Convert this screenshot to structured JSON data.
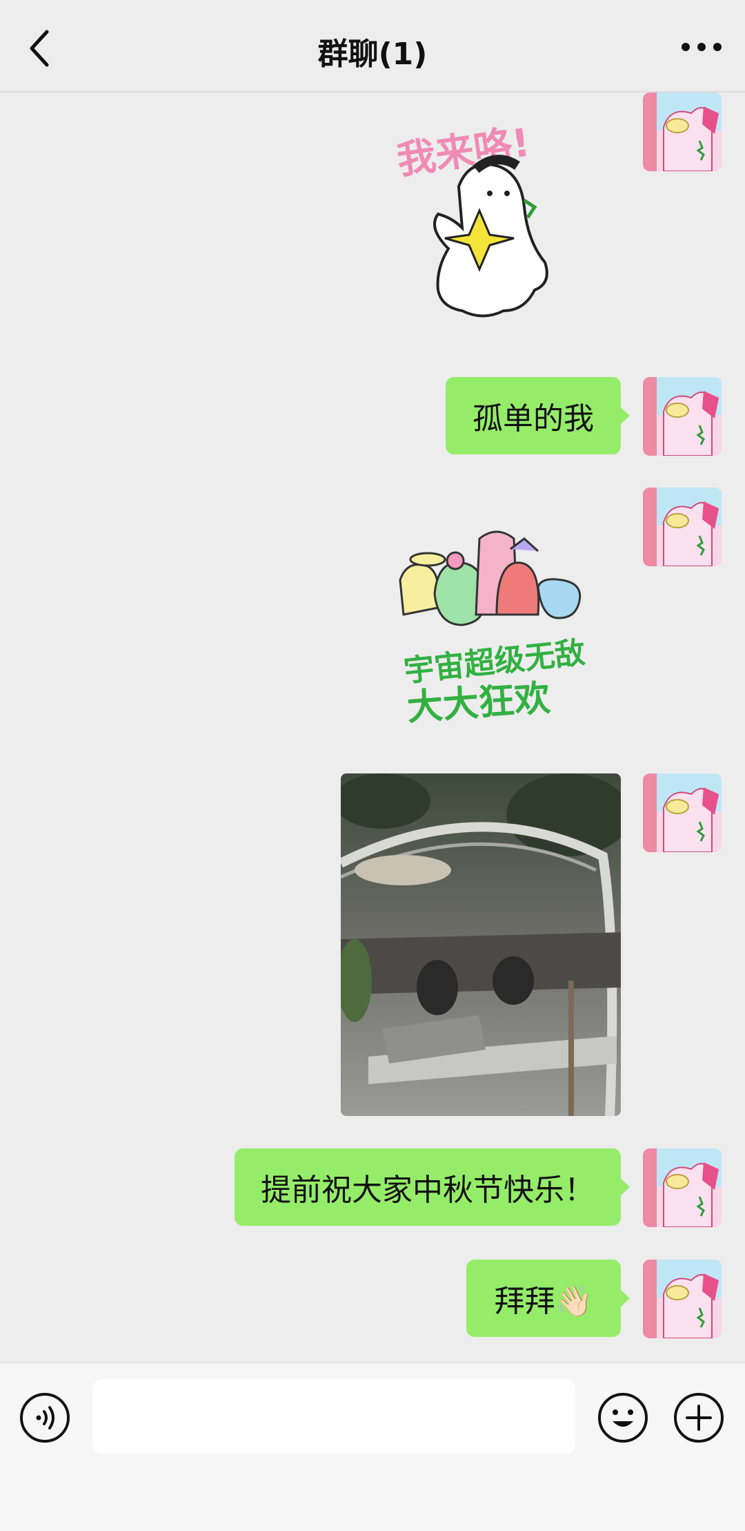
{
  "header": {
    "title": "群聊(1)",
    "back_icon": "chevron-left-icon",
    "more_icon": "more-dots-icon"
  },
  "messages": [
    {
      "type": "sticker",
      "text": "我来咯!",
      "description_icon": "ghost-sticker"
    },
    {
      "type": "text",
      "text": "孤单的我"
    },
    {
      "type": "sticker",
      "text": "宇宙超级无敌大大狂欢",
      "description_icon": "party-sticker"
    },
    {
      "type": "image",
      "description_icon": "cafe-photo"
    },
    {
      "type": "text",
      "text": "提前祝大家中秋节快乐！"
    },
    {
      "type": "text",
      "text": "拜拜👋🏻"
    }
  ],
  "input_bar": {
    "voice_icon": "voice-icon",
    "emoji_icon": "emoji-icon",
    "plus_icon": "plus-icon",
    "input_value": ""
  },
  "colors": {
    "background": "#ededed",
    "bubble": "#95ec69",
    "input_bar": "#f6f6f6"
  }
}
